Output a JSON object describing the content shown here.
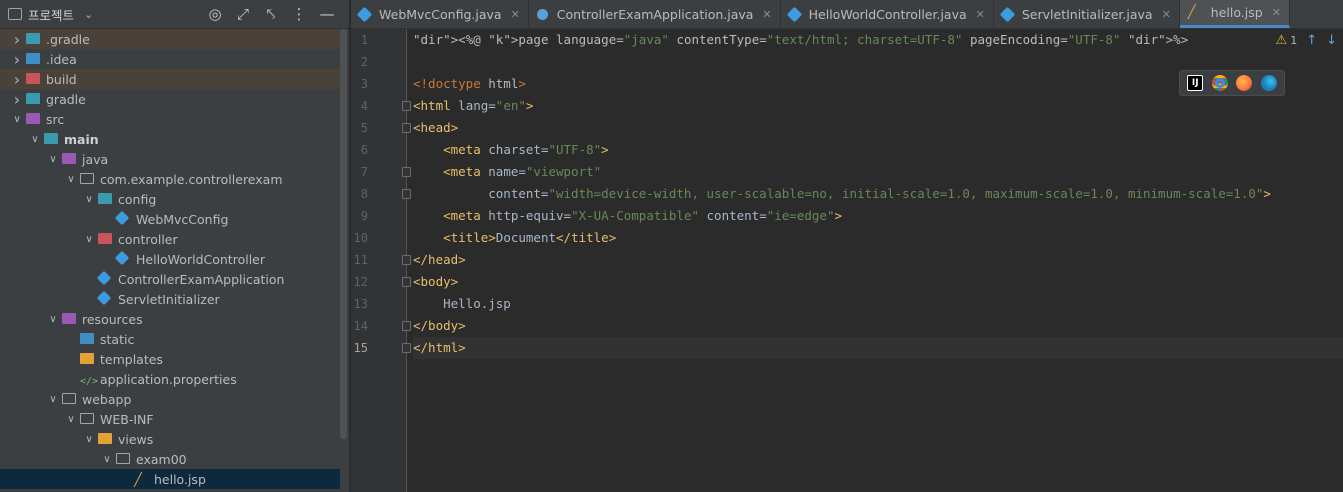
{
  "panel": {
    "title": "프로젝트",
    "tree": [
      {
        "label": ".gradle",
        "depth": 1,
        "arrow": "right",
        "icon": "folder-gradle",
        "style": "hl"
      },
      {
        "label": ".idea",
        "depth": 1,
        "arrow": "right",
        "icon": "folder-blue",
        "style": ""
      },
      {
        "label": "build",
        "depth": 1,
        "arrow": "right",
        "icon": "folder-build",
        "style": "hl2"
      },
      {
        "label": "gradle",
        "depth": 1,
        "arrow": "right",
        "icon": "folder-teal",
        "style": ""
      },
      {
        "label": "src",
        "depth": 1,
        "arrow": "down",
        "icon": "folder-source",
        "style": ""
      },
      {
        "label": "main",
        "depth": 2,
        "arrow": "down",
        "icon": "folder-teal",
        "style": "",
        "bold": true
      },
      {
        "label": "java",
        "depth": 3,
        "arrow": "down",
        "icon": "folder-java",
        "style": ""
      },
      {
        "label": "com.example.controllerexam",
        "depth": 4,
        "arrow": "down",
        "icon": "folder-package",
        "style": ""
      },
      {
        "label": "config",
        "depth": 5,
        "arrow": "down",
        "icon": "folder-config",
        "style": ""
      },
      {
        "label": "WebMvcConfig",
        "depth": 6,
        "arrow": "",
        "icon": "class",
        "style": ""
      },
      {
        "label": "controller",
        "depth": 5,
        "arrow": "down",
        "icon": "folder-controller",
        "style": ""
      },
      {
        "label": "HelloWorldController",
        "depth": 6,
        "arrow": "",
        "icon": "class",
        "style": ""
      },
      {
        "label": "ControllerExamApplication",
        "depth": 5,
        "arrow": "",
        "icon": "app-class",
        "style": ""
      },
      {
        "label": "ServletInitializer",
        "depth": 5,
        "arrow": "",
        "icon": "class",
        "style": ""
      },
      {
        "label": "resources",
        "depth": 3,
        "arrow": "down",
        "icon": "folder-resources",
        "style": ""
      },
      {
        "label": "static",
        "depth": 4,
        "arrow": "",
        "icon": "folder-web",
        "style": ""
      },
      {
        "label": "templates",
        "depth": 4,
        "arrow": "",
        "icon": "folder-orange",
        "style": ""
      },
      {
        "label": "application.properties",
        "depth": 4,
        "arrow": "",
        "icon": "properties",
        "style": ""
      },
      {
        "label": "webapp",
        "depth": 3,
        "arrow": "down",
        "icon": "folder-plain",
        "style": ""
      },
      {
        "label": "WEB-INF",
        "depth": 4,
        "arrow": "down",
        "icon": "folder-plain",
        "style": ""
      },
      {
        "label": "views",
        "depth": 5,
        "arrow": "down",
        "icon": "folder-views",
        "style": ""
      },
      {
        "label": "exam00",
        "depth": 6,
        "arrow": "down",
        "icon": "folder-plain",
        "style": ""
      },
      {
        "label": "hello.jsp",
        "depth": 7,
        "arrow": "",
        "icon": "jsp",
        "style": "sel"
      }
    ]
  },
  "tabs": [
    {
      "label": "WebMvcConfig.java",
      "icon": "class",
      "active": false
    },
    {
      "label": "ControllerExamApplication.java",
      "icon": "app",
      "active": false
    },
    {
      "label": "HelloWorldController.java",
      "icon": "class",
      "active": false
    },
    {
      "label": "ServletInitializer.java",
      "icon": "class",
      "active": false
    },
    {
      "label": "hello.jsp",
      "icon": "jsp",
      "active": true
    }
  ],
  "editor": {
    "warning_count": "1",
    "current_line": 15,
    "lines": [
      "<%@ page language=\"java\" contentType=\"text/html; charset=UTF-8\" pageEncoding=\"UTF-8\" %>",
      "",
      "<!doctype html>",
      "<html lang=\"en\">",
      "<head>",
      "    <meta charset=\"UTF-8\">",
      "    <meta name=\"viewport\"",
      "          content=\"width=device-width, user-scalable=no, initial-scale=1.0, maximum-scale=1.0, minimum-scale=1.0\">",
      "    <meta http-equiv=\"X-UA-Compatible\" content=\"ie=edge\">",
      "    <title>Document</title>",
      "</head>",
      "<body>",
      "    Hello.jsp",
      "</body>",
      "</html>"
    ]
  },
  "colors": {
    "background": "#2b2b2b",
    "panel": "#3c3f41",
    "selection": "#0d293e",
    "tag": "#e8bf6a",
    "string": "#6a8759",
    "keyword": "#cc7832"
  }
}
